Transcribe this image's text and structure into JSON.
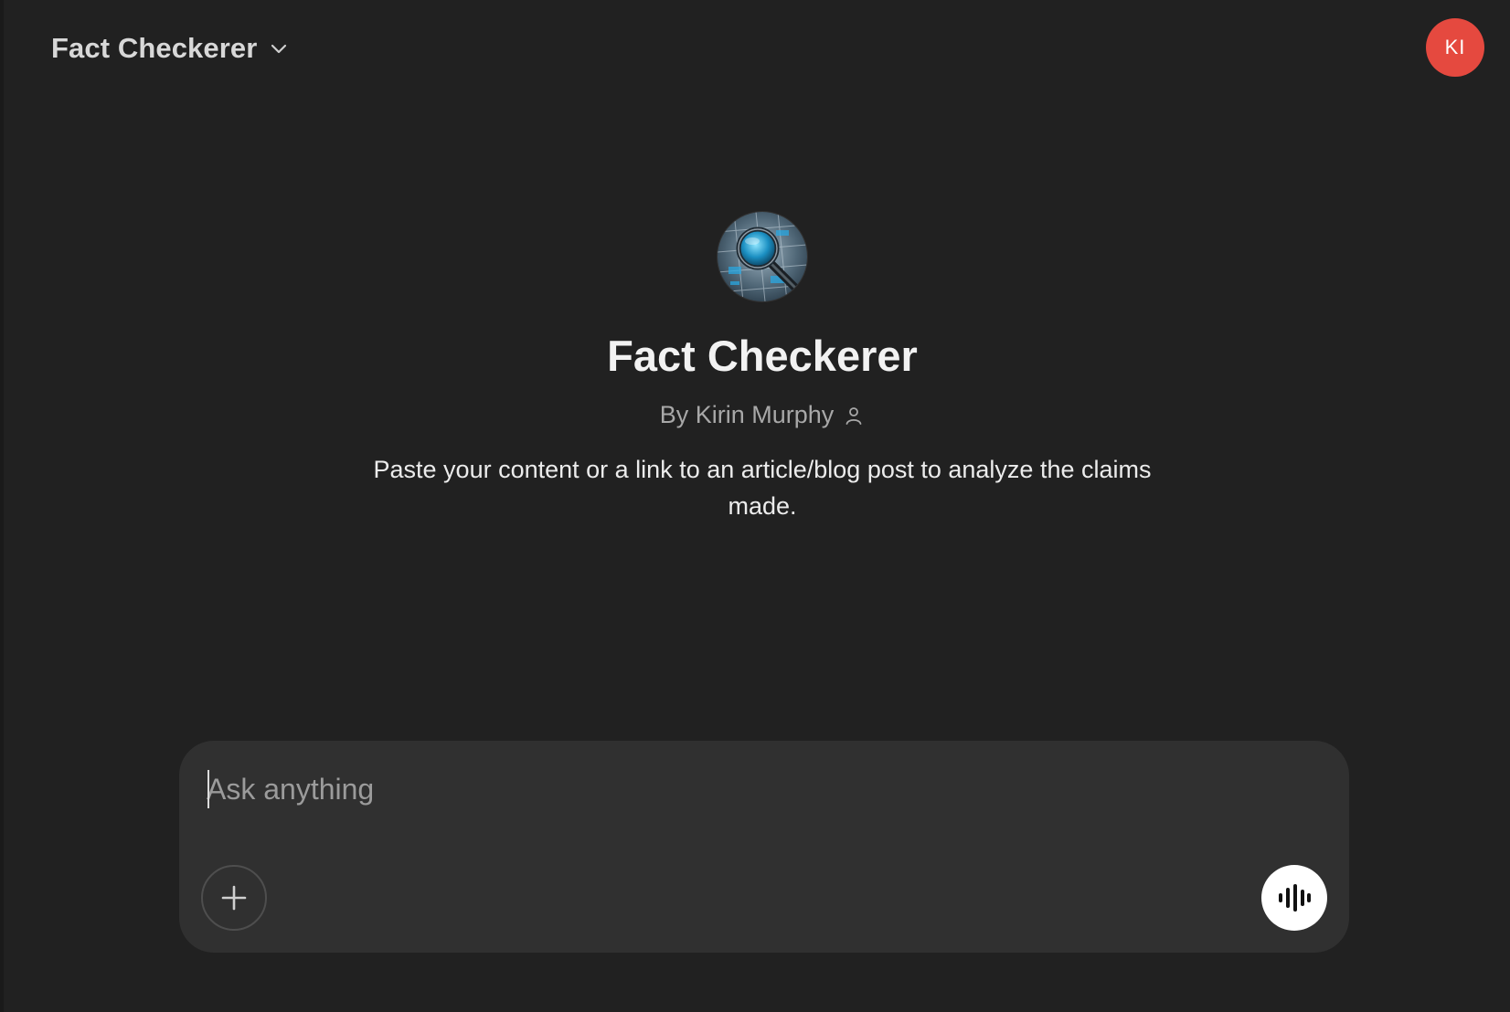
{
  "header": {
    "model_name": "Fact Checkerer",
    "model_menu_icon": "chevron-down-icon",
    "avatar_initials": "KI",
    "avatar_color": "#e5493f"
  },
  "gpt": {
    "image_icon": "magnifying-glass-icon",
    "title": "Fact Checkerer",
    "author": "By Kirin Murphy",
    "author_icon": "person-icon",
    "description": "Paste your content or a link to an article/blog post to analyze the claims made."
  },
  "composer": {
    "placeholder": "Ask anything",
    "value": "",
    "attach_icon": "plus-icon",
    "voice_icon": "voice-waveform-icon"
  },
  "colors": {
    "background": "#212121",
    "composer_background": "#303030",
    "voice_button": "#ffffff"
  }
}
